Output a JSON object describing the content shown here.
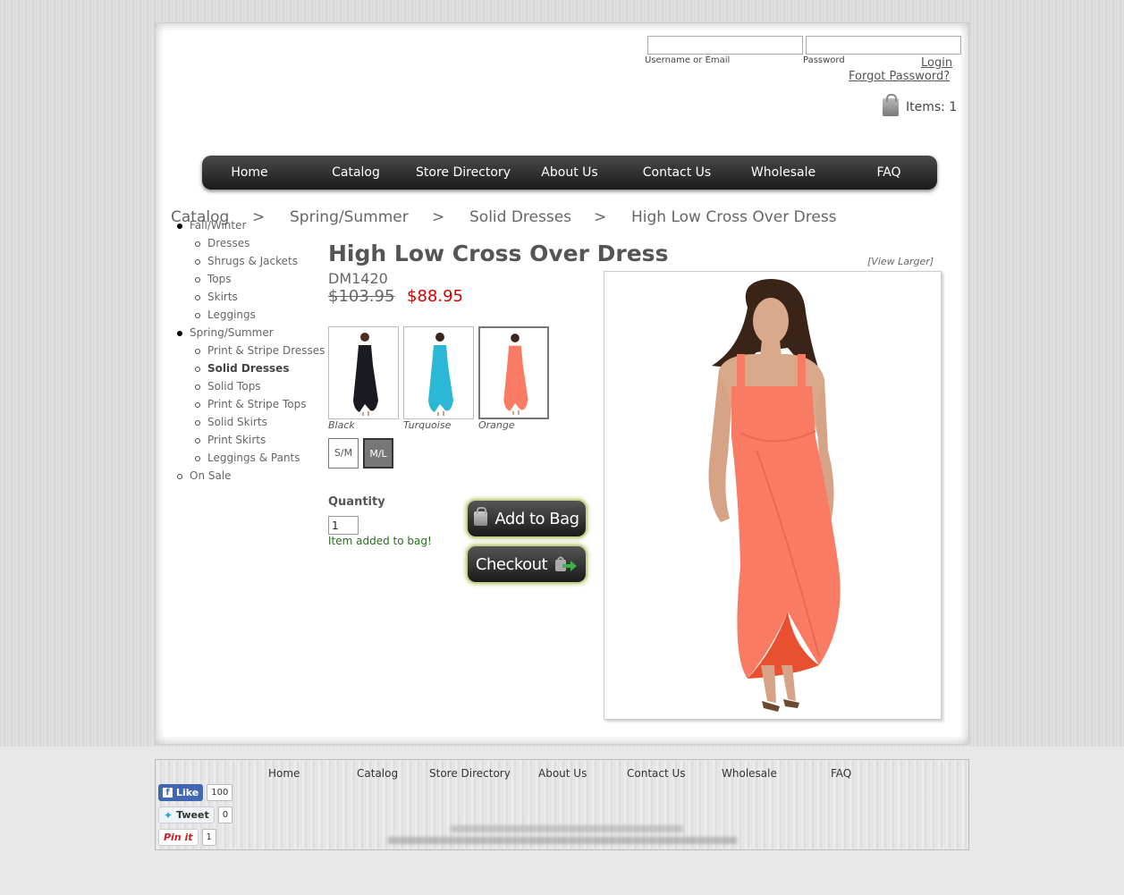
{
  "header": {
    "username_label": "Username or Email",
    "password_label": "Password",
    "login_label": "Login",
    "forgot_label": "Forgot Password?",
    "cart_label": "Items: 1"
  },
  "nav": [
    "Home",
    "Catalog",
    "Store Directory",
    "About Us",
    "Contact Us",
    "Wholesale",
    "FAQ"
  ],
  "breadcrumb": {
    "items": [
      "Catalog",
      "Spring/Summer",
      "Solid Dresses",
      "High Low Cross Over Dress"
    ],
    "separator": ">"
  },
  "sidebar": {
    "fall_winter": {
      "label": "Fall/Winter",
      "children": [
        "Dresses",
        "Shrugs & Jackets",
        "Tops",
        "Skirts",
        "Leggings"
      ]
    },
    "spring_summer": {
      "label": "Spring/Summer",
      "children": [
        "Print & Stripe Dresses",
        "Solid Dresses",
        "Solid Tops",
        "Print & Stripe Tops",
        "Solid Skirts",
        "Print Skirts",
        "Leggings & Pants"
      ],
      "active": "Solid Dresses"
    },
    "on_sale": {
      "label": "On Sale"
    }
  },
  "product": {
    "title": "High Low Cross Over Dress",
    "sku": "DM1420",
    "old_price": "$103.95",
    "new_price": "$88.95",
    "view_larger": "[View Larger]",
    "colors": [
      {
        "label": "Black",
        "hex": "#1a1a22"
      },
      {
        "label": "Turquoise",
        "hex": "#2bb8d6"
      },
      {
        "label": "Orange",
        "hex": "#fa7b63"
      }
    ],
    "selected_color": "Orange",
    "sizes": [
      "S/M",
      "M/L"
    ],
    "selected_size": "M/L",
    "quantity_label": "Quantity",
    "quantity_value": "1",
    "added_message": "Item added to bag!",
    "add_to_bag_label": "Add to Bag",
    "checkout_label": "Checkout"
  },
  "footer": {
    "nav": [
      "Home",
      "Catalog",
      "Store Directory",
      "About Us",
      "Contact Us",
      "Wholesale",
      "FAQ"
    ],
    "social": {
      "like_label": "Like",
      "like_count": "100",
      "tweet_label": "Tweet",
      "tweet_count": "0",
      "pin_label": "Pin it",
      "pin_count": "1"
    }
  }
}
